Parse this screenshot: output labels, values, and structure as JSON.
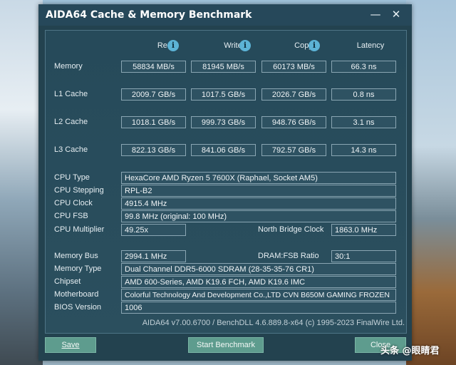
{
  "window": {
    "title": "AIDA64 Cache & Memory Benchmark",
    "minimize": "—",
    "close": "✕"
  },
  "columns": {
    "read": "Read",
    "write": "Write",
    "copy": "Copy",
    "latency": "Latency",
    "info": "i"
  },
  "rows": [
    {
      "label": "Memory",
      "read": "58834 MB/s",
      "write": "81945 MB/s",
      "copy": "60173 MB/s",
      "latency": "66.3 ns"
    },
    {
      "label": "L1 Cache",
      "read": "2009.7 GB/s",
      "write": "1017.5 GB/s",
      "copy": "2026.7 GB/s",
      "latency": "0.8 ns"
    },
    {
      "label": "L2 Cache",
      "read": "1018.1 GB/s",
      "write": "999.73 GB/s",
      "copy": "948.76 GB/s",
      "latency": "3.1 ns"
    },
    {
      "label": "L3 Cache",
      "read": "822.13 GB/s",
      "write": "841.06 GB/s",
      "copy": "792.57 GB/s",
      "latency": "14.3 ns"
    }
  ],
  "cpu": {
    "type_label": "CPU Type",
    "type": "HexaCore AMD Ryzen 5 7600X  (Raphael, Socket AM5)",
    "stepping_label": "CPU Stepping",
    "stepping": "RPL-B2",
    "clock_label": "CPU Clock",
    "clock": "4915.4 MHz",
    "fsb_label": "CPU FSB",
    "fsb": "99.8 MHz  (original: 100 MHz)",
    "multiplier_label": "CPU Multiplier",
    "multiplier": "49.25x",
    "nb_clock_label": "North Bridge Clock",
    "nb_clock": "1863.0 MHz"
  },
  "memory": {
    "bus_label": "Memory Bus",
    "bus": "2994.1 MHz",
    "ratio_label": "DRAM:FSB Ratio",
    "ratio": "30:1",
    "type_label": "Memory Type",
    "type": "Dual Channel DDR5-6000 SDRAM  (28-35-35-76 CR1)",
    "chipset_label": "Chipset",
    "chipset": "AMD 600-Series, AMD K19.6 FCH, AMD K19.6 IMC",
    "motherboard_label": "Motherboard",
    "motherboard": "Colorful Technology And Development Co.,LTD CVN B650M GAMING FROZEN",
    "bios_label": "BIOS Version",
    "bios": "1006"
  },
  "footer": {
    "version": "AIDA64 v7.00.6700 / BenchDLL 4.6.889.8-x64  (c) 1995-2023 FinalWire Ltd."
  },
  "buttons": {
    "save": "Save",
    "start": "Start Benchmark",
    "close": "Close"
  },
  "watermark": "头条 @眼睛君"
}
